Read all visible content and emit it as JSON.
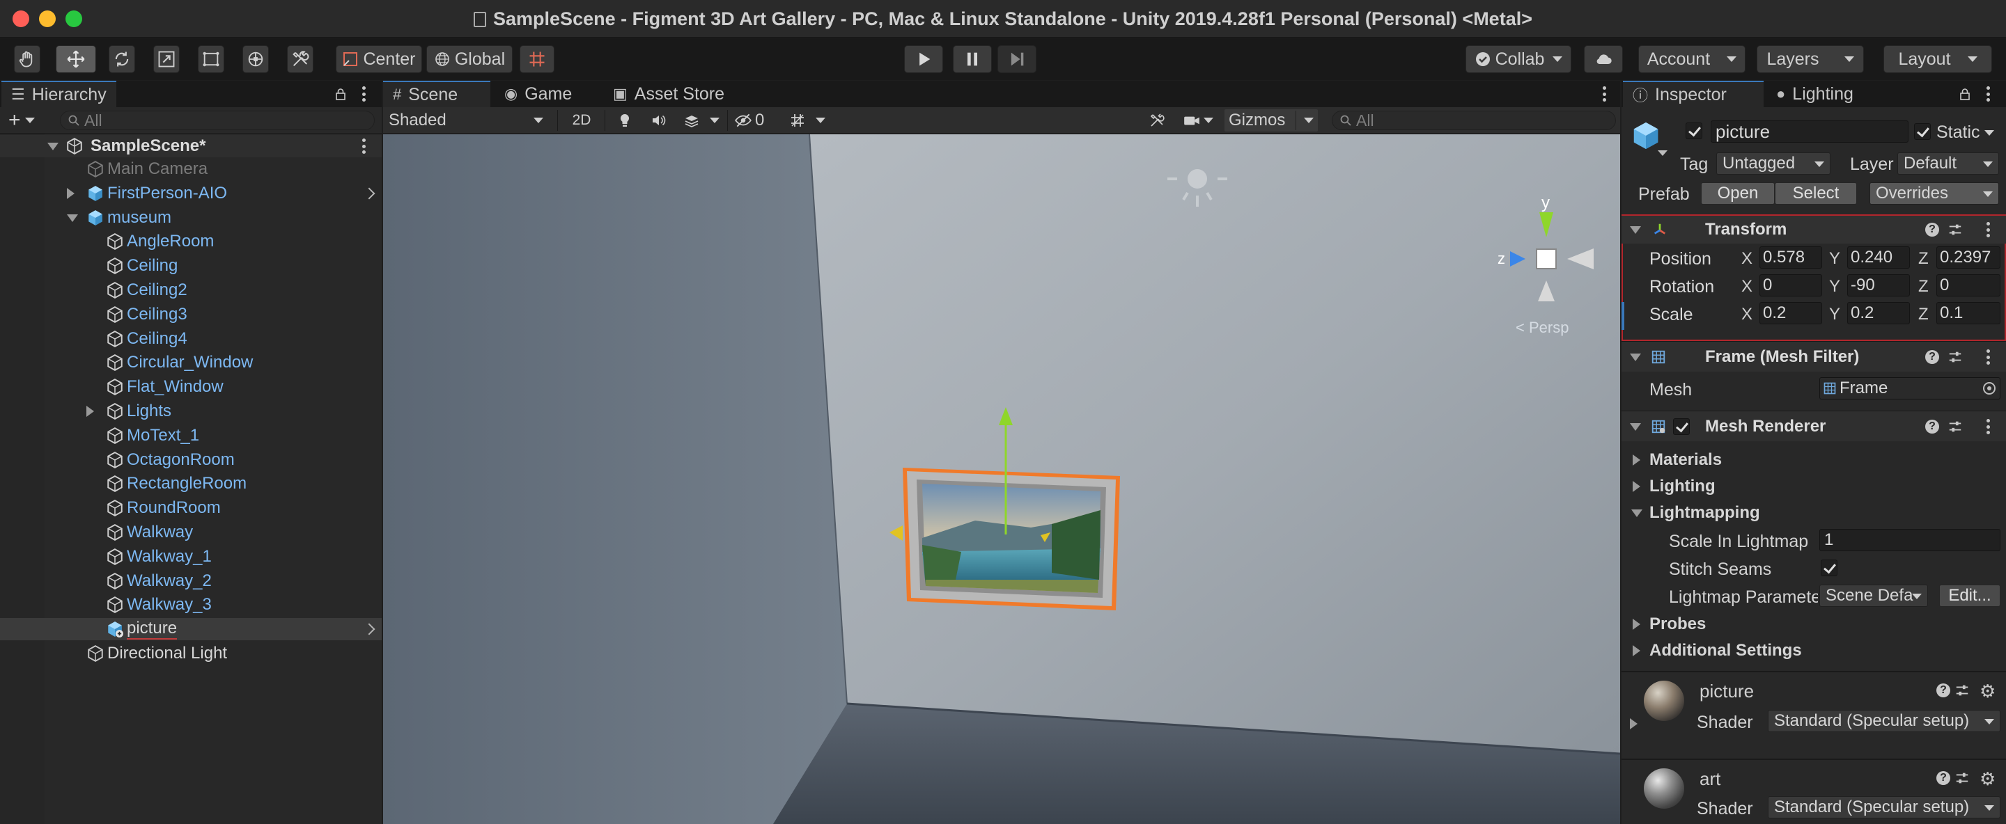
{
  "window": {
    "title": "SampleScene - Figment 3D Art Gallery - PC, Mac & Linux Standalone - Unity 2019.4.28f1 Personal (Personal) <Metal>"
  },
  "toolbar": {
    "pivot_label": "Center",
    "space_label": "Global",
    "collab_label": "Collab",
    "account_label": "Account",
    "layers_label": "Layers",
    "layout_label": "Layout"
  },
  "hierarchy": {
    "tab_label": "Hierarchy",
    "search_placeholder": "All",
    "scene_name": "SampleScene*",
    "items": [
      {
        "label": "Main Camera"
      },
      {
        "label": "FirstPerson-AIO"
      },
      {
        "label": "museum"
      },
      {
        "label": "AngleRoom"
      },
      {
        "label": "Ceiling"
      },
      {
        "label": "Ceiling2"
      },
      {
        "label": "Ceiling3"
      },
      {
        "label": "Ceiling4"
      },
      {
        "label": "Circular_Window"
      },
      {
        "label": "Flat_Window"
      },
      {
        "label": "Lights"
      },
      {
        "label": "MoText_1"
      },
      {
        "label": "OctagonRoom"
      },
      {
        "label": "RectangleRoom"
      },
      {
        "label": "RoundRoom"
      },
      {
        "label": "Walkway"
      },
      {
        "label": "Walkway_1"
      },
      {
        "label": "Walkway_2"
      },
      {
        "label": "Walkway_3"
      },
      {
        "label": "picture"
      },
      {
        "label": "Directional Light"
      }
    ]
  },
  "scene_view": {
    "tabs": [
      {
        "label": "Scene"
      },
      {
        "label": "Game"
      },
      {
        "label": "Asset Store"
      }
    ],
    "draw_mode": "Shaded",
    "mode_2d": "2D",
    "hidden_count": "0",
    "gizmos_label": "Gizmos",
    "search_placeholder": "All",
    "axis_y": "y",
    "axis_z": "z",
    "persp_label": "< Persp"
  },
  "inspector": {
    "tabs": [
      {
        "label": "Inspector"
      },
      {
        "label": "Lighting"
      }
    ],
    "object_name": "picture",
    "static_label": "Static",
    "tag_label": "Tag",
    "tag_value": "Untagged",
    "layer_label": "Layer",
    "layer_value": "Default",
    "prefab_label": "Prefab",
    "open_label": "Open",
    "select_label": "Select",
    "overrides_label": "Overrides",
    "transform": {
      "title": "Transform",
      "position_label": "Position",
      "rotation_label": "Rotation",
      "scale_label": "Scale",
      "x_label": "X",
      "y_label": "Y",
      "z_label": "Z",
      "position": {
        "x": "0.578",
        "y": "0.240",
        "z": "0.2397"
      },
      "rotation": {
        "x": "0",
        "y": "-90",
        "z": "0"
      },
      "scale": {
        "x": "0.2",
        "y": "0.2",
        "z": "0.1"
      }
    },
    "mesh_filter": {
      "title": "Frame (Mesh Filter)",
      "mesh_label": "Mesh",
      "mesh_value": "Frame"
    },
    "mesh_renderer": {
      "title": "Mesh Renderer",
      "materials_label": "Materials",
      "lighting_label": "Lighting",
      "lightmapping_label": "Lightmapping",
      "scale_in_lightmap_label": "Scale In Lightmap",
      "scale_in_lightmap_value": "1",
      "stitch_seams_label": "Stitch Seams",
      "lightmap_params_label": "Lightmap Paramete",
      "lightmap_params_value": "Scene Defa",
      "edit_label": "Edit...",
      "probes_label": "Probes",
      "additional_settings_label": "Additional Settings"
    },
    "materials": [
      {
        "name": "picture",
        "shader_label": "Shader",
        "shader_value": "Standard (Specular setup)"
      },
      {
        "name": "art",
        "shader_label": "Shader",
        "shader_value": "Standard (Specular setup)"
      }
    ]
  },
  "colors": {
    "accent_blue": "#3a79bb",
    "prefab_text": "#7db8f2",
    "selection_orange": "#f07a2a",
    "transform_highlight": "#b2262c",
    "gizmo_y": "#8fd62a",
    "gizmo_z": "#3b86e8"
  }
}
